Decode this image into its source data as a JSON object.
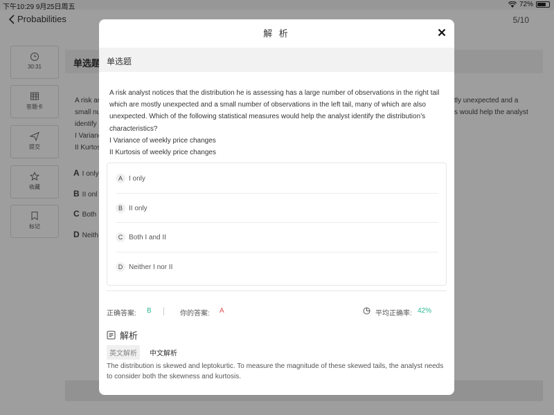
{
  "status_bar": {
    "time": "下午10:29",
    "date": "9月25日周五",
    "battery": "72%",
    "battery_level": 0.72
  },
  "nav": {
    "back_label": "Probabilities",
    "counter": "5/10"
  },
  "sidebar": {
    "items": [
      {
        "label": "30:31",
        "icon": "clock-icon"
      },
      {
        "label": "答题卡",
        "icon": "answer-card-icon"
      },
      {
        "label": "提交",
        "icon": "send-icon"
      },
      {
        "label": "收藏",
        "icon": "star-icon"
      },
      {
        "label": "标记",
        "icon": "bookmark-icon"
      }
    ]
  },
  "background": {
    "question_type": "单选题",
    "text_left": [
      "A risk ar",
      "small nu",
      "identify",
      "I Varianc",
      "II Kurtos"
    ],
    "text_right": [
      "tly unexpected and a",
      "s would help the analyst"
    ],
    "option_letters": [
      "A",
      "B",
      "C",
      "D"
    ],
    "option_texts": [
      "I only",
      "II onl",
      "Both",
      "Neith"
    ]
  },
  "modal": {
    "title": "解 析",
    "question_type": "单选题",
    "question_lines": [
      "A risk analyst notices that the distribution he is assessing has a large number of observations in the right tail",
      "which are mostly unexpected and a small number of observations in the left tail, many of which are also",
      "unexpected. Which of the following statistical measures would help the analyst identify the distribution’s",
      "characteristics?",
      "I Variance of weekly price changes",
      "II Kurtosis of weekly price changes"
    ],
    "options": [
      {
        "letter": "A",
        "text": "I only"
      },
      {
        "letter": "B",
        "text": "II only"
      },
      {
        "letter": "C",
        "text": "Both I and II"
      },
      {
        "letter": "D",
        "text": "Neither I nor II"
      }
    ],
    "correct_label": "正确答案:",
    "correct_value": "B",
    "your_label": "你的答案:",
    "your_value": "A",
    "rate_label": "平均正确率:",
    "rate_value": "42%",
    "analysis_title": "解析",
    "tabs": [
      "英文解析",
      "中文解析"
    ],
    "explanation": "The distribution is skewed and leptokurtic. To measure the magnitude of these skewed tails, the analyst needs to consider both the skewness and kurtosis."
  },
  "colors": {
    "correct": "#27b894",
    "wrong": "#e05555",
    "overlay": "rgba(0,0,0,0.38)"
  }
}
